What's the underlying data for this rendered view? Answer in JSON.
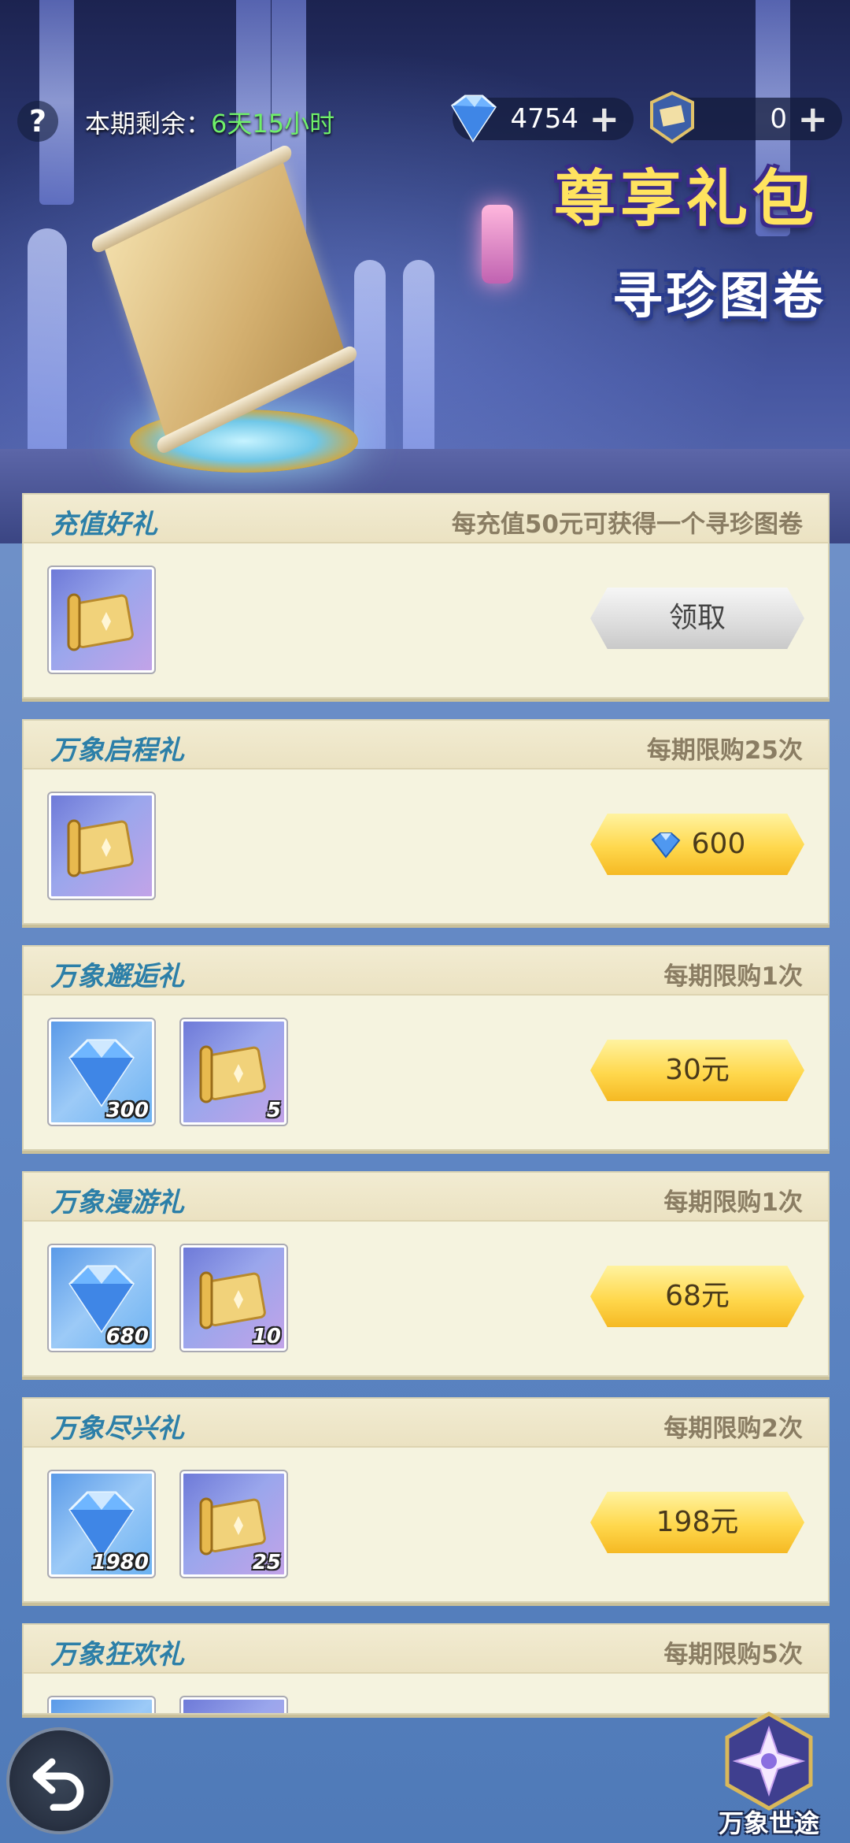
{
  "header": {
    "help_icon": "question-mark-icon",
    "period_label": "本期剩余：",
    "period_value": "6天15小时",
    "currencies": [
      {
        "icon": "diamond-gem-icon",
        "amount": "4754",
        "add": "+"
      },
      {
        "icon": "treasure-map-ticket-icon",
        "amount": "0",
        "add": "+"
      }
    ]
  },
  "banner": {
    "title": "尊享礼包",
    "subtitle": "寻珍图卷"
  },
  "packs": [
    {
      "title": "充值好礼",
      "limit": "每充值50元可获得一个寻珍图卷",
      "items": [
        {
          "icon": "treasure-scroll-icon",
          "qty": ""
        }
      ],
      "button": {
        "label": "领取",
        "style": "grey"
      }
    },
    {
      "title": "万象启程礼",
      "limit": "每期限购25次",
      "items": [
        {
          "icon": "treasure-scroll-icon",
          "qty": ""
        }
      ],
      "button": {
        "label": "600",
        "style": "gold",
        "icon": "diamond-gem-icon"
      }
    },
    {
      "title": "万象邂逅礼",
      "limit": "每期限购1次",
      "items": [
        {
          "icon": "diamond-gem-icon",
          "qty": "300"
        },
        {
          "icon": "treasure-scroll-icon",
          "qty": "5"
        }
      ],
      "button": {
        "label": "30元",
        "style": "gold"
      }
    },
    {
      "title": "万象漫游礼",
      "limit": "每期限购1次",
      "items": [
        {
          "icon": "diamond-gem-icon",
          "qty": "680"
        },
        {
          "icon": "treasure-scroll-icon",
          "qty": "10"
        }
      ],
      "button": {
        "label": "68元",
        "style": "gold"
      }
    },
    {
      "title": "万象尽兴礼",
      "limit": "每期限购2次",
      "items": [
        {
          "icon": "diamond-gem-icon",
          "qty": "1980"
        },
        {
          "icon": "treasure-scroll-icon",
          "qty": "25"
        }
      ],
      "button": {
        "label": "198元",
        "style": "gold"
      }
    },
    {
      "title": "万象狂欢礼",
      "limit": "每期限购5次",
      "items": [
        {
          "icon": "diamond-gem-icon",
          "qty": ""
        },
        {
          "icon": "treasure-scroll-icon",
          "qty": ""
        }
      ],
      "button": {
        "label": "",
        "style": "gold"
      }
    }
  ],
  "footer": {
    "back_icon": "back-arrow-icon",
    "world_label": "万象世途",
    "world_icon": "star-emblem-icon"
  }
}
